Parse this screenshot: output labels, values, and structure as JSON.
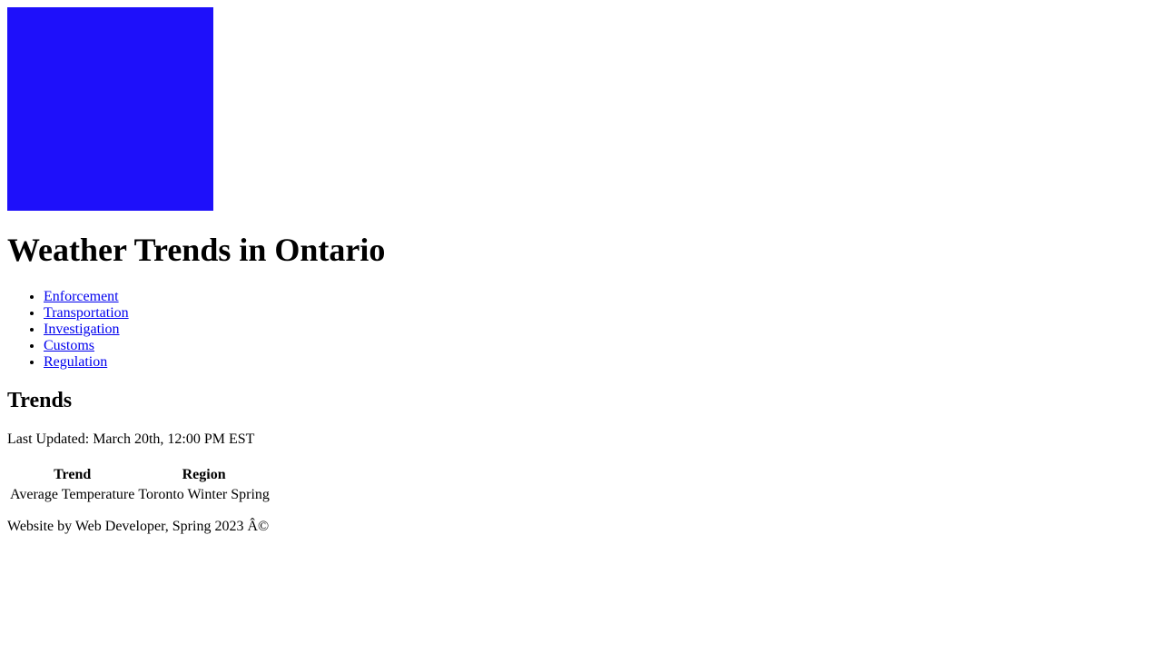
{
  "header": {
    "logo_color": "#1e10fa",
    "title": "Weather Trends in Ontario"
  },
  "nav": {
    "items": [
      {
        "label": "Enforcement"
      },
      {
        "label": "Transportation"
      },
      {
        "label": "Investigation"
      },
      {
        "label": "Customs"
      },
      {
        "label": "Regulation"
      }
    ],
    "link_color": "#0000ee"
  },
  "trends": {
    "heading": "Trends",
    "last_updated": "Last Updated: March 20th, 12:00 PM EST",
    "table": {
      "headers": [
        "Trend",
        "Region"
      ],
      "rows": [
        [
          "Average Temperature",
          "Toronto Winter Spring"
        ]
      ]
    }
  },
  "footer": {
    "text": "Website by Web Developer, Spring 2023 Â©"
  }
}
